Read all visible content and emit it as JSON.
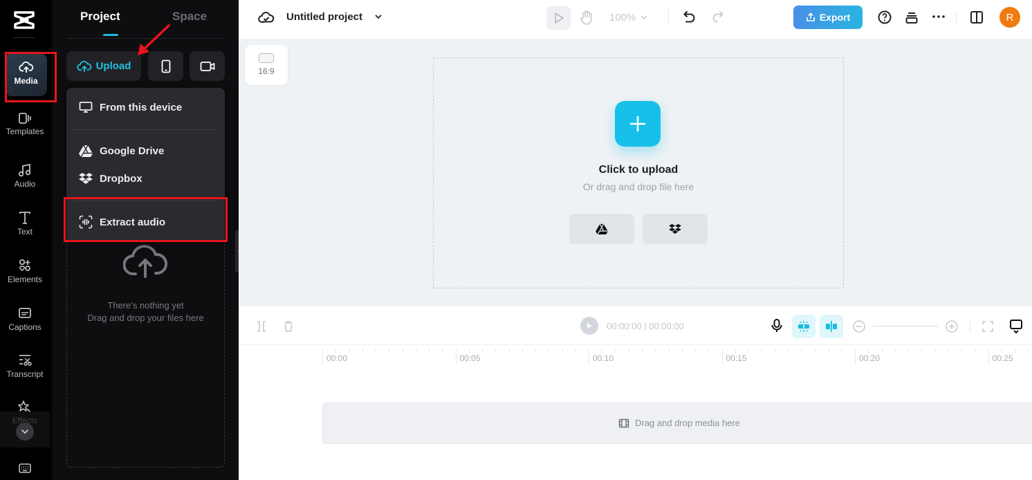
{
  "app": {
    "name": "CapCut"
  },
  "rail": {
    "items": [
      {
        "id": "media",
        "label": "Media",
        "icon": "cloud-upload-icon",
        "active": true
      },
      {
        "id": "templates",
        "label": "Templates",
        "icon": "templates-icon"
      },
      {
        "id": "audio",
        "label": "Audio",
        "icon": "music-note-icon"
      },
      {
        "id": "text",
        "label": "Text",
        "icon": "text-icon"
      },
      {
        "id": "elements",
        "label": "Elements",
        "icon": "elements-icon"
      },
      {
        "id": "captions",
        "label": "Captions",
        "icon": "captions-icon"
      },
      {
        "id": "transcript",
        "label": "Transcript",
        "icon": "transcript-icon"
      },
      {
        "id": "effects",
        "label": "Effects",
        "icon": "effects-star-icon"
      }
    ],
    "expand_icon": "chevron-down-icon",
    "keyboard_icon": "keyboard-icon"
  },
  "panel": {
    "tabs": [
      {
        "label": "Project",
        "active": true
      },
      {
        "label": "Space",
        "active": false
      }
    ],
    "upload_label": "Upload",
    "accent": "#17bde0",
    "menu": {
      "items": [
        {
          "label": "From this device",
          "icon": "monitor-icon"
        },
        {
          "label": "Google Drive",
          "icon": "google-drive-icon"
        },
        {
          "label": "Dropbox",
          "icon": "dropbox-icon"
        },
        {
          "label": "Extract audio",
          "icon": "extract-audio-icon"
        }
      ]
    },
    "empty": {
      "line1": "There’s nothing yet",
      "line2": "Drag and drop your files here"
    }
  },
  "topbar": {
    "project_title": "Untitled project",
    "zoom": "100%",
    "export_label": "Export",
    "avatar_initial": "R",
    "avatar_color": "#f07b10"
  },
  "canvas": {
    "ratio": "16:9",
    "click_to_upload": "Click to upload",
    "or_drag": "Or drag and drop file here"
  },
  "timeline": {
    "current_time": "00:00:00",
    "total_time": "00:00:00",
    "ruler_labels": [
      "00:00",
      "00:05",
      "00:10",
      "00:15",
      "00:20",
      "00:25"
    ],
    "track_hint": "Drag and drop media here"
  },
  "annotations": {
    "color": "#e8141b"
  }
}
